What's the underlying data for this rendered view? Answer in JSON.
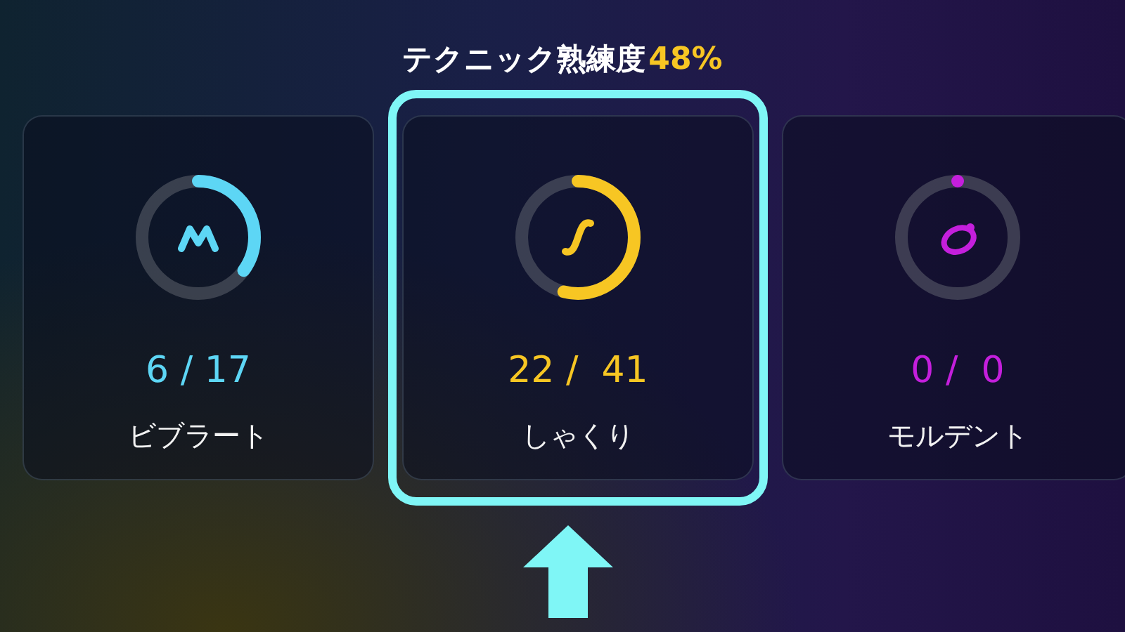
{
  "header": {
    "label": "テクニック熟練度",
    "value": "48%"
  },
  "techniques": [
    {
      "kind": "vibrato",
      "count": "6 / 17",
      "name": "ビブラート",
      "level": 0.35,
      "color": "#5dd6f5",
      "selected": false
    },
    {
      "kind": "shakuri",
      "count": "22 /  41",
      "name": "しゃくり",
      "level": 0.54,
      "color": "#f7c623",
      "selected": true
    },
    {
      "kind": "mordent",
      "count": "0 /  0",
      "name": "モルデント",
      "level": 0,
      "color": "#c41fdc",
      "selected": false
    }
  ]
}
